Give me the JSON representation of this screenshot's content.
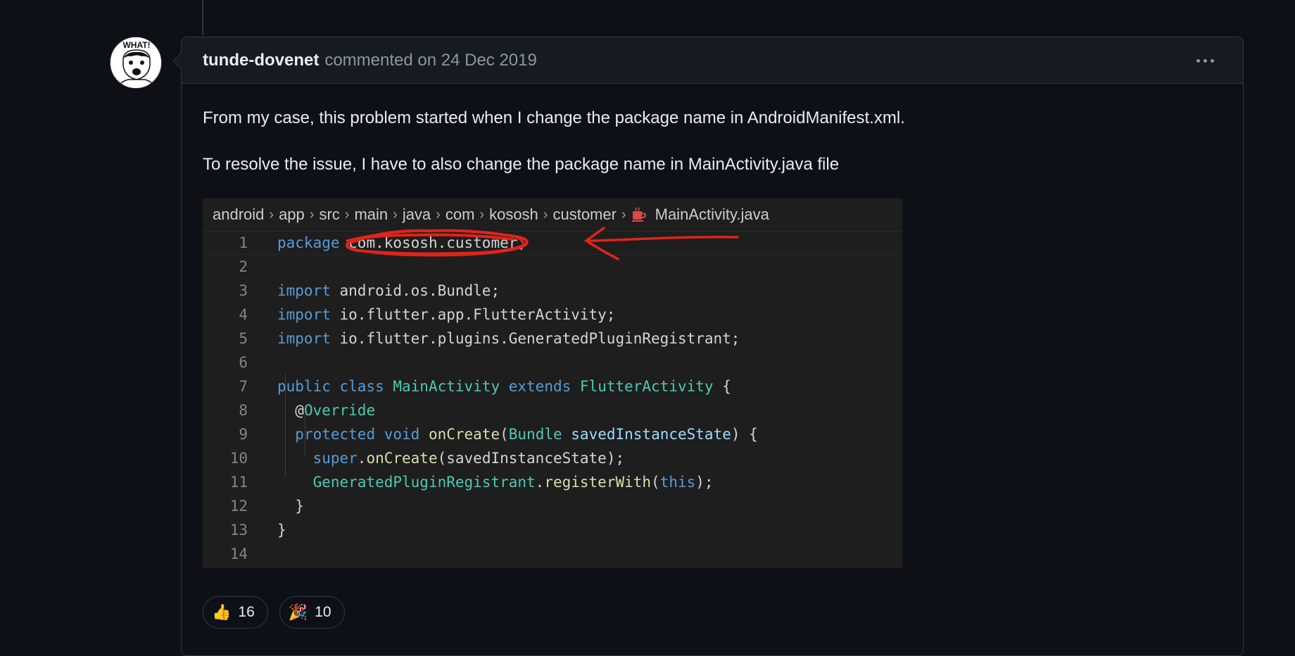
{
  "comment": {
    "author": "tunde-dovenet",
    "meta": "commented on 24 Dec 2019",
    "avatar_text": "WHAT!",
    "paragraphs": [
      "From my case, this problem started when I change the package name in AndroidManifest.xml.",
      "To resolve the issue, I have to also change the package name in MainActivity.java file"
    ]
  },
  "code_image": {
    "breadcrumb": [
      "android",
      "app",
      "src",
      "main",
      "java",
      "com",
      "kososh",
      "customer",
      "MainActivity.java"
    ],
    "lines": [
      {
        "n": "1",
        "tokens": [
          [
            "kw",
            "package "
          ],
          [
            "",
            "com.kososh.customer;"
          ]
        ]
      },
      {
        "n": "2",
        "tokens": []
      },
      {
        "n": "3",
        "tokens": [
          [
            "kw",
            "import "
          ],
          [
            "",
            "android.os.Bundle;"
          ]
        ]
      },
      {
        "n": "4",
        "tokens": [
          [
            "kw",
            "import "
          ],
          [
            "",
            "io.flutter.app.FlutterActivity;"
          ]
        ]
      },
      {
        "n": "5",
        "tokens": [
          [
            "kw",
            "import "
          ],
          [
            "",
            "io.flutter.plugins.GeneratedPluginRegistrant;"
          ]
        ]
      },
      {
        "n": "6",
        "tokens": []
      },
      {
        "n": "7",
        "tokens": [
          [
            "kw",
            "public class "
          ],
          [
            "ty",
            "MainActivity "
          ],
          [
            "kw",
            "extends "
          ],
          [
            "ty",
            "FlutterActivity "
          ],
          [
            "",
            "{"
          ]
        ]
      },
      {
        "n": "8",
        "tokens": [
          [
            "",
            "  @"
          ],
          [
            "an",
            "Override"
          ]
        ]
      },
      {
        "n": "9",
        "tokens": [
          [
            "",
            "  "
          ],
          [
            "kw",
            "protected void "
          ],
          [
            "fn",
            "onCreate"
          ],
          [
            "",
            "("
          ],
          [
            "ty",
            "Bundle "
          ],
          [
            "pr",
            "savedInstanceState"
          ],
          [
            "",
            ") {"
          ]
        ]
      },
      {
        "n": "10",
        "tokens": [
          [
            "",
            "    "
          ],
          [
            "kw",
            "super"
          ],
          [
            "",
            "."
          ],
          [
            "fn",
            "onCreate"
          ],
          [
            "",
            "(savedInstanceState);"
          ]
        ]
      },
      {
        "n": "11",
        "tokens": [
          [
            "",
            "    "
          ],
          [
            "ty",
            "GeneratedPluginRegistrant"
          ],
          [
            "",
            "."
          ],
          [
            "fn",
            "registerWith"
          ],
          [
            "",
            "("
          ],
          [
            "kw",
            "this"
          ],
          [
            "",
            ");"
          ]
        ]
      },
      {
        "n": "12",
        "tokens": [
          [
            "",
            "  }"
          ]
        ]
      },
      {
        "n": "13",
        "tokens": [
          [
            "",
            "}"
          ]
        ]
      },
      {
        "n": "14",
        "tokens": []
      }
    ]
  },
  "reactions": [
    {
      "emoji": "👍",
      "count": "16",
      "name": "thumbs-up"
    },
    {
      "emoji": "🎉",
      "count": "10",
      "name": "hooray"
    }
  ],
  "colors": {
    "background": "#0d1117",
    "header_bg": "#161b22",
    "border": "#30363d",
    "muted_text": "#8d96a0",
    "annotation_red": "#e0241b"
  }
}
